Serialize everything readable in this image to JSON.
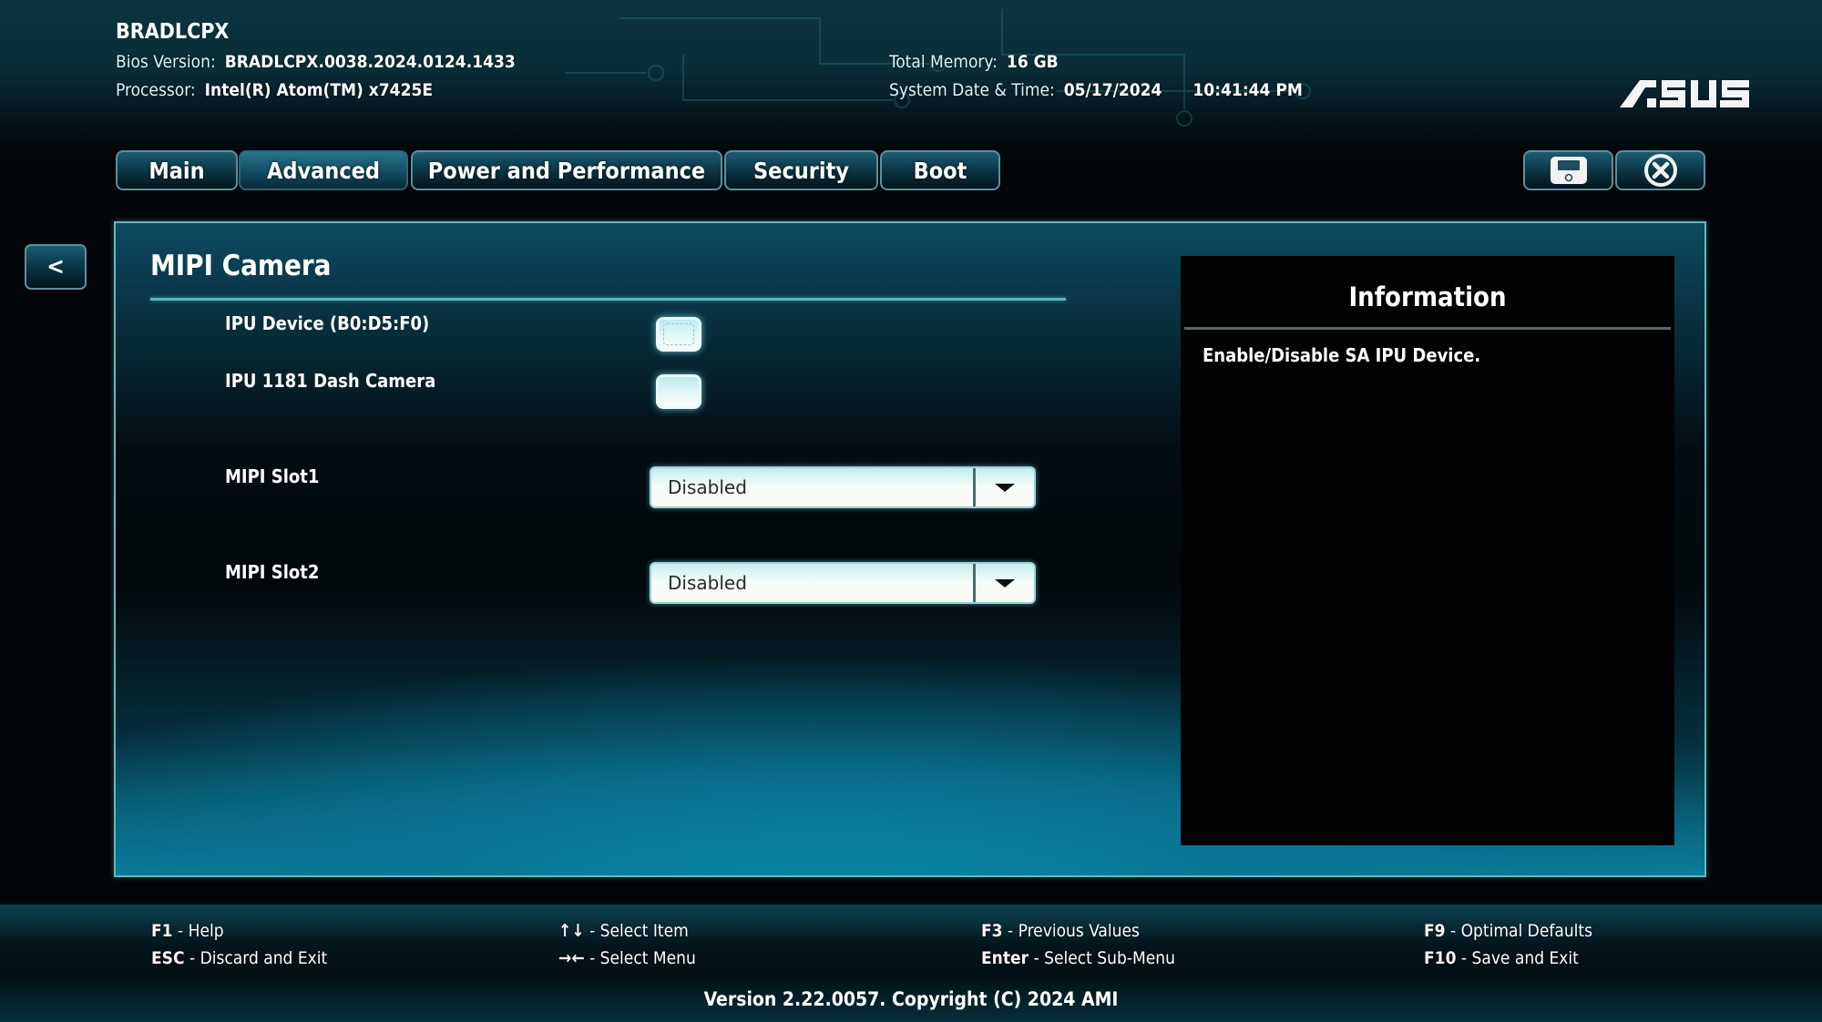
{
  "header": {
    "board_name": "BRADLCPX",
    "bios_version_label": "Bios Version:",
    "bios_version": "BRADLCPX.0038.2024.0124.1433",
    "processor_label": "Processor:",
    "processor": "Intel(R) Atom(TM) x7425E",
    "memory_label": "Total Memory:",
    "memory": "16 GB",
    "datetime_label": "System Date & Time:",
    "date": "05/17/2024",
    "time": "10:41:44 PM",
    "brand": "ASUS"
  },
  "tabs": [
    {
      "label": "Main",
      "active": false
    },
    {
      "label": "Advanced",
      "active": true
    },
    {
      "label": "Power and Performance",
      "active": false
    },
    {
      "label": "Security",
      "active": false
    },
    {
      "label": "Boot",
      "active": false
    }
  ],
  "toolbar": {
    "save_icon": "floppy-disk-icon",
    "exit_icon": "circle-x-icon"
  },
  "back_button": "<",
  "page": {
    "title": "MIPI Camera",
    "settings": [
      {
        "label": "IPU Device (B0:D5:F0)",
        "type": "checkbox",
        "checked": false,
        "focused": true
      },
      {
        "label": "IPU 1181 Dash Camera",
        "type": "checkbox",
        "checked": false,
        "focused": false
      },
      {
        "label": "MIPI Slot1",
        "type": "dropdown",
        "value": "Disabled"
      },
      {
        "label": "MIPI Slot2",
        "type": "dropdown",
        "value": "Disabled"
      }
    ]
  },
  "info": {
    "title": "Information",
    "text": "Enable/Disable SA IPU Device."
  },
  "footer": {
    "hints": [
      {
        "key": "F1",
        "desc": " - Help"
      },
      {
        "key": "ESC",
        "desc": " - Discard and Exit"
      },
      {
        "key": "↑↓",
        "desc": " - Select Item"
      },
      {
        "key": "→←",
        "desc": " - Select Menu"
      },
      {
        "key": "F3",
        "desc": " - Previous Values"
      },
      {
        "key": "Enter",
        "desc": " - Select Sub-Menu"
      },
      {
        "key": "F9",
        "desc": " - Optimal Defaults"
      },
      {
        "key": "F10",
        "desc": " - Save and Exit"
      }
    ],
    "version": "Version 2.22.0057. Copyright (C) 2024 AMI"
  },
  "colors": {
    "accent": "#67b5bb",
    "tab_border": "#5d8fa0",
    "background": "#020608"
  }
}
